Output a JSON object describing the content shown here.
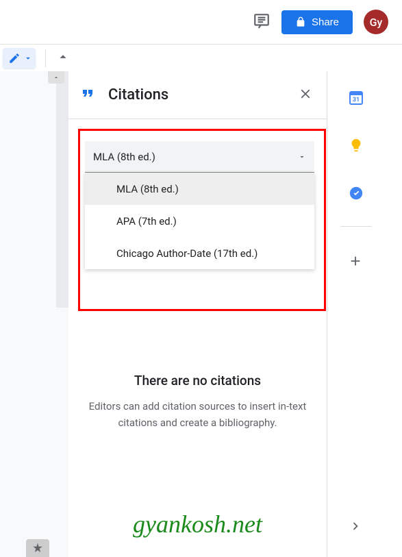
{
  "topbar": {
    "share_label": "Share",
    "avatar_text": "Gy"
  },
  "panel": {
    "title": "Citations"
  },
  "dropdown": {
    "selected": "MLA (8th ed.)",
    "options": [
      "MLA (8th ed.)",
      "APA (7th ed.)",
      "Chicago Author-Date (17th ed.)"
    ]
  },
  "empty": {
    "title": "There are no citations",
    "description": "Editors can add citation sources to insert in-text citations and create a bibliography."
  },
  "watermark": "gyankosh.net",
  "rail": {
    "calendar_day": "31"
  }
}
